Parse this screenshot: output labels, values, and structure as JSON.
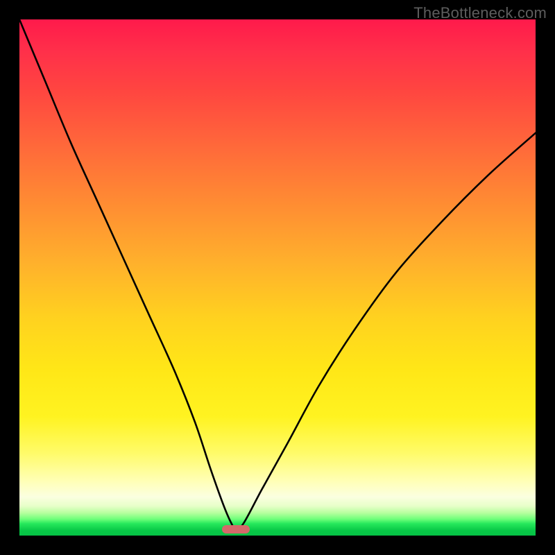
{
  "watermark": "TheBottleneck.com",
  "chart_data": {
    "type": "line",
    "title": "",
    "xlabel": "",
    "ylabel": "",
    "xlim": [
      0,
      100
    ],
    "ylim": [
      0,
      100
    ],
    "grid": false,
    "legend": false,
    "annotations": [],
    "series": [
      {
        "name": "curve",
        "x": [
          0,
          5,
          10,
          15,
          20,
          25,
          30,
          34,
          37,
          39.5,
          41,
          42,
          43.5,
          47,
          52,
          58,
          65,
          73,
          82,
          91,
          100
        ],
        "values": [
          100,
          88,
          76,
          65,
          54,
          43,
          32,
          22,
          13,
          6,
          2.5,
          1.2,
          2.5,
          9,
          18,
          29,
          40,
          51,
          61,
          70,
          78
        ]
      }
    ],
    "marker": {
      "x": 42,
      "y": 1.2
    },
    "gradient_stops": [
      {
        "pos": 0,
        "color": "#ff1a4b"
      },
      {
        "pos": 0.35,
        "color": "#ff8a33"
      },
      {
        "pos": 0.68,
        "color": "#ffe717"
      },
      {
        "pos": 0.93,
        "color": "#fbffe0"
      },
      {
        "pos": 1.0,
        "color": "#06c245"
      }
    ]
  }
}
